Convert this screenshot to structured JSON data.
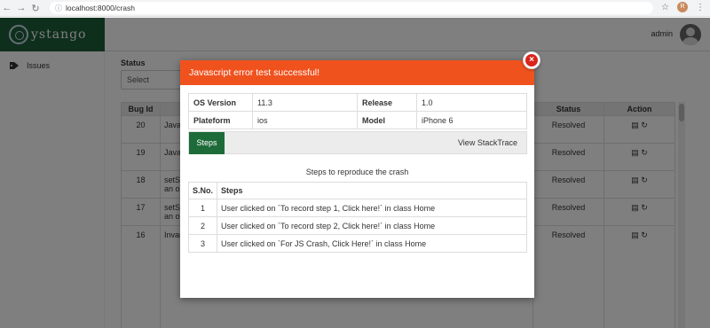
{
  "browser": {
    "url": "localhost:8000/crash",
    "profile_initial": "R"
  },
  "header": {
    "logo_text": "ystango",
    "user_name": "admin"
  },
  "sidebar": {
    "items": [
      {
        "label": "Issues",
        "icon": "tag-icon"
      }
    ]
  },
  "filters": {
    "status_label": "Status",
    "status_select_value": "Select"
  },
  "table": {
    "columns": [
      "Bug Id",
      "Status",
      "Action"
    ],
    "rows": [
      {
        "id": "20",
        "desc": "Javas",
        "status": "Resolved"
      },
      {
        "id": "19",
        "desc": "Javas",
        "status": "Resolved"
      },
      {
        "id": "18",
        "desc": "setSta",
        "desc2": "an ob",
        "status": "Resolved"
      },
      {
        "id": "17",
        "desc": "setSta",
        "desc2": "an ob",
        "status": "Resolved"
      },
      {
        "id": "16",
        "desc": "Invari",
        "status": "Resolved"
      }
    ]
  },
  "modal": {
    "title": "Javascript error test successful!",
    "info": {
      "os_version_label": "OS Version",
      "os_version": "11.3",
      "release_label": "Release",
      "release": "1.0",
      "platform_label": "Plateform",
      "platform": "ios",
      "model_label": "Model",
      "model": "iPhone 6"
    },
    "tabs": {
      "steps": "Steps",
      "stacktrace": "View StackTrace"
    },
    "steps_title": "Steps to reproduce the crash",
    "steps_columns": [
      "S.No.",
      "Steps"
    ],
    "steps": [
      {
        "n": "1",
        "text": "User clicked on `To record step 1, Click here!` in class Home"
      },
      {
        "n": "2",
        "text": "User clicked on `To record step 2, Click here!` in class Home"
      },
      {
        "n": "3",
        "text": "User clicked on `For JS Crash, Click Here!` in class Home"
      }
    ]
  },
  "colors": {
    "modal_header": "#f0521e",
    "brand_green": "#1e6b3a",
    "close_red": "#d9241c"
  }
}
